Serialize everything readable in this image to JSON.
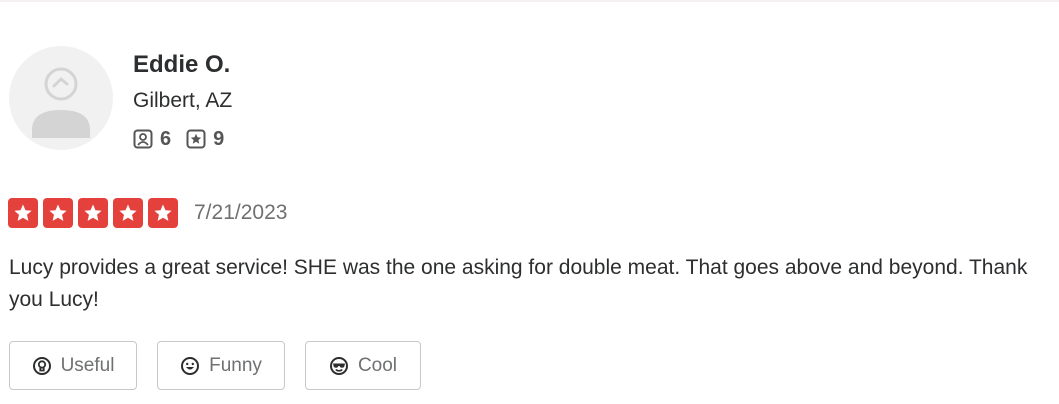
{
  "reviewer": {
    "name": "Eddie O.",
    "location": "Gilbert, AZ",
    "friends_count": "6",
    "reviews_count": "9"
  },
  "review": {
    "rating": 5,
    "max_rating": 5,
    "date": "7/21/2023",
    "text": "Lucy provides a great service! SHE was the one asking for double meat. That goes above and beyond. Thank you Lucy!"
  },
  "actions": {
    "useful_label": "Useful",
    "funny_label": "Funny",
    "cool_label": "Cool"
  },
  "icons": {
    "avatar": "default-user-avatar-icon",
    "friends": "friends-icon",
    "reviews": "review-star-icon",
    "star": "star-icon",
    "useful": "lightbulb-icon",
    "funny": "smiley-icon",
    "cool": "sunglasses-icon"
  },
  "colors": {
    "star_background": "#e4413c",
    "text": "#2d2e2f",
    "muted_text": "#6e7072",
    "button_border": "#c8c9ca"
  }
}
